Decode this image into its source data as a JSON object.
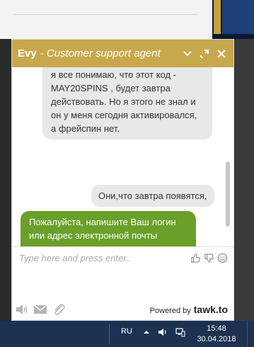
{
  "header": {
    "agent_name": "Evy",
    "agent_role": "- Customer support agent"
  },
  "messages": [
    {
      "sender": "visitor",
      "text": "я все понимаю, что этот код - MAY20SPINS , будет завтра действовать. Но я этого не знал и он у меня сегодня активировался, а фрейспин нет."
    },
    {
      "sender": "visitor",
      "text": "Они,что завтра появятся,"
    },
    {
      "sender": "agent",
      "text": "Пожалуйста, напишите Ваш логин или адрес электронной почты которую указали при регистрации."
    }
  ],
  "input": {
    "placeholder": "Type here and press enter.."
  },
  "footer": {
    "powered_label": "Powered by",
    "brand": "tawk.to"
  },
  "taskbar": {
    "language": "RU",
    "time": "15:48",
    "date": "30.04.2018"
  },
  "colors": {
    "header": "#c8a84c",
    "agent_bubble": "#6aa02a",
    "visitor_bubble": "#e8e8e8",
    "taskbar": "#1d3150"
  },
  "icons": [
    "minimize-icon",
    "popout-icon",
    "close-icon",
    "thumbs-up-icon",
    "thumbs-down-icon",
    "emoji-icon",
    "sound-icon",
    "email-icon",
    "attachment-icon",
    "tray-arrow-icon",
    "volume-icon",
    "network-icon"
  ]
}
